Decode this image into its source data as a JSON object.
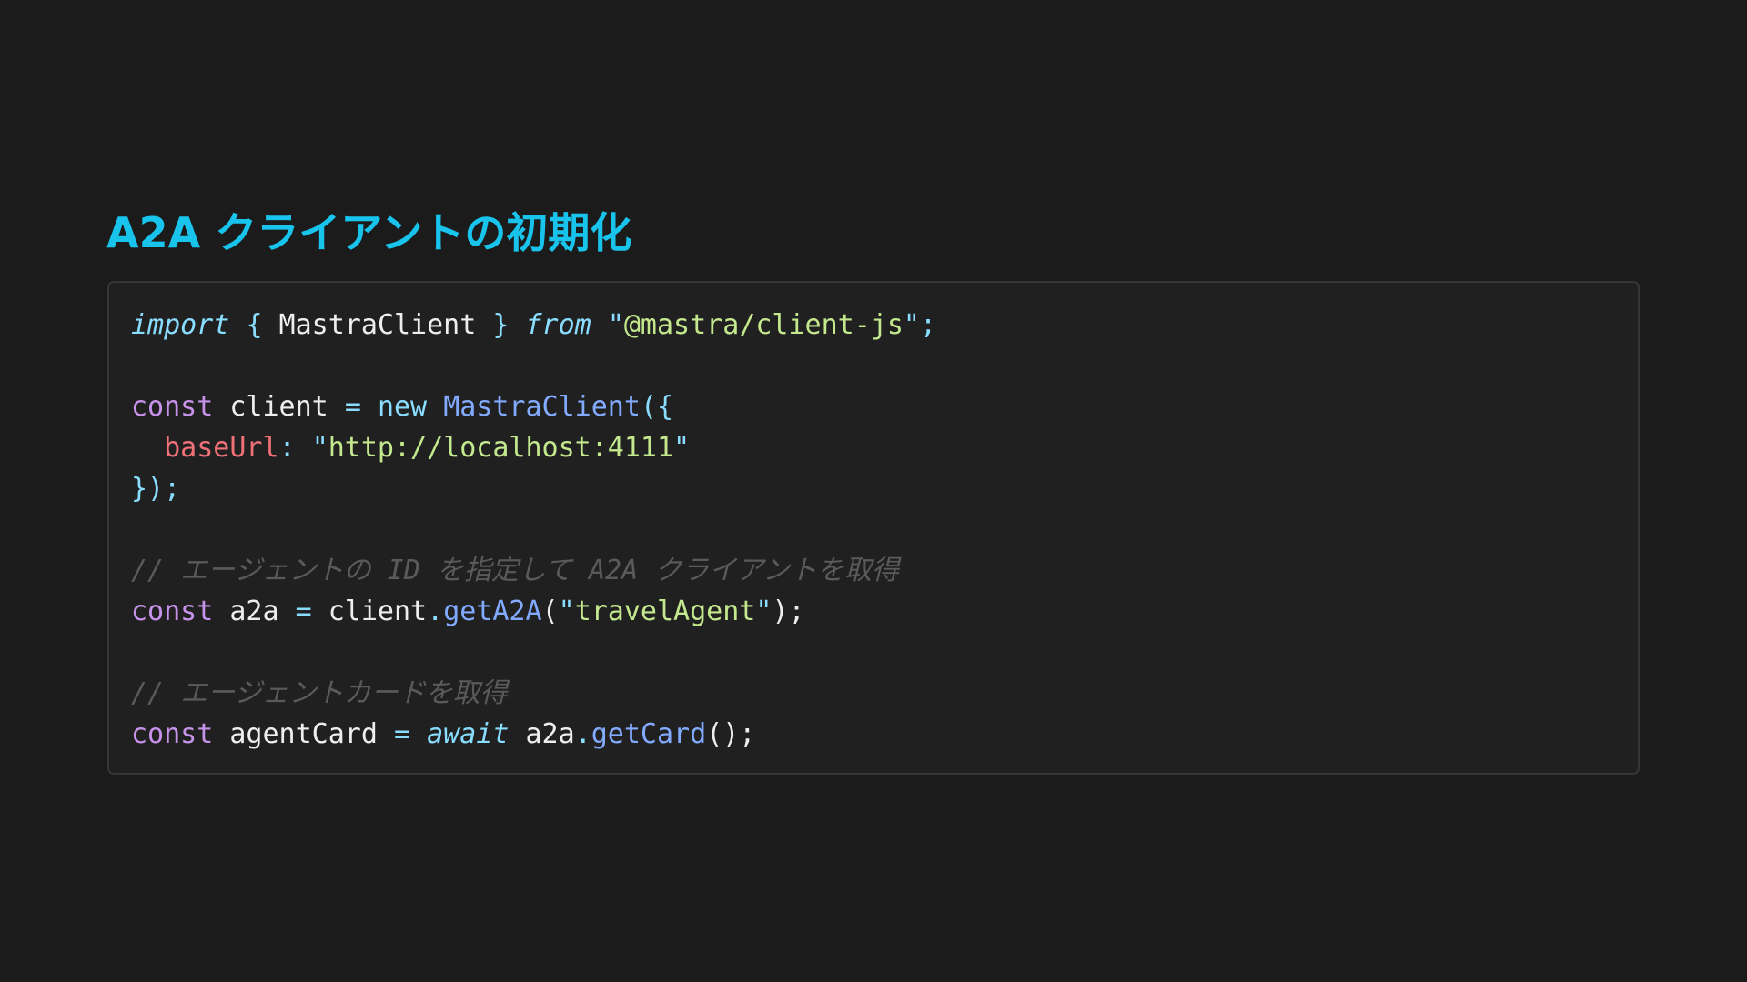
{
  "slide": {
    "title": "A2A クライアントの初期化"
  },
  "code": {
    "lines": [
      [
        {
          "t": "import",
          "k": "kw-it"
        },
        {
          "t": " ",
          "k": "ident"
        },
        {
          "t": "{",
          "k": "punc"
        },
        {
          "t": " MastraClient ",
          "k": "ident"
        },
        {
          "t": "}",
          "k": "punc"
        },
        {
          "t": " ",
          "k": "ident"
        },
        {
          "t": "from",
          "k": "kw-it"
        },
        {
          "t": " ",
          "k": "ident"
        },
        {
          "t": "\"",
          "k": "punc"
        },
        {
          "t": "@mastra/client-js",
          "k": "str"
        },
        {
          "t": "\"",
          "k": "punc"
        },
        {
          "t": ";",
          "k": "punc"
        }
      ],
      [],
      [
        {
          "t": "const",
          "k": "kw"
        },
        {
          "t": " client ",
          "k": "ident"
        },
        {
          "t": "=",
          "k": "op"
        },
        {
          "t": " ",
          "k": "ident"
        },
        {
          "t": "new",
          "k": "op"
        },
        {
          "t": " ",
          "k": "ident"
        },
        {
          "t": "MastraClient",
          "k": "cls"
        },
        {
          "t": "({",
          "k": "punc"
        }
      ],
      [
        {
          "t": "  ",
          "k": "ident"
        },
        {
          "t": "baseUrl",
          "k": "prop"
        },
        {
          "t": ":",
          "k": "punc"
        },
        {
          "t": " ",
          "k": "ident"
        },
        {
          "t": "\"",
          "k": "punc"
        },
        {
          "t": "http://localhost:4111",
          "k": "str"
        },
        {
          "t": "\"",
          "k": "punc"
        }
      ],
      [
        {
          "t": "});",
          "k": "punc"
        }
      ],
      [],
      [
        {
          "t": "// エージェントの ID を指定して A2A クライアントを取得",
          "k": "cmt"
        }
      ],
      [
        {
          "t": "const",
          "k": "kw"
        },
        {
          "t": " a2a ",
          "k": "ident"
        },
        {
          "t": "=",
          "k": "op"
        },
        {
          "t": " client",
          "k": "ident"
        },
        {
          "t": ".",
          "k": "punc"
        },
        {
          "t": "getA2A",
          "k": "fn"
        },
        {
          "t": "(",
          "k": "ident"
        },
        {
          "t": "\"",
          "k": "punc"
        },
        {
          "t": "travelAgent",
          "k": "str"
        },
        {
          "t": "\"",
          "k": "punc"
        },
        {
          "t": ");",
          "k": "ident"
        }
      ],
      [],
      [
        {
          "t": "// エージェントカードを取得",
          "k": "cmt"
        }
      ],
      [
        {
          "t": "const",
          "k": "kw"
        },
        {
          "t": " agentCard ",
          "k": "ident"
        },
        {
          "t": "=",
          "k": "op"
        },
        {
          "t": " ",
          "k": "ident"
        },
        {
          "t": "await",
          "k": "kw-it"
        },
        {
          "t": " a2a",
          "k": "ident"
        },
        {
          "t": ".",
          "k": "punc"
        },
        {
          "t": "getCard",
          "k": "fn"
        },
        {
          "t": "();",
          "k": "ident"
        }
      ]
    ]
  },
  "colors": {
    "background": "#1b1b1b",
    "panel": "#202020",
    "title": "#18c4ec",
    "keyword": "#c792ea",
    "operator": "#89ddff",
    "function": "#82aaff",
    "string": "#c3e88d",
    "property": "#f07178",
    "comment": "#5a5a5a"
  }
}
